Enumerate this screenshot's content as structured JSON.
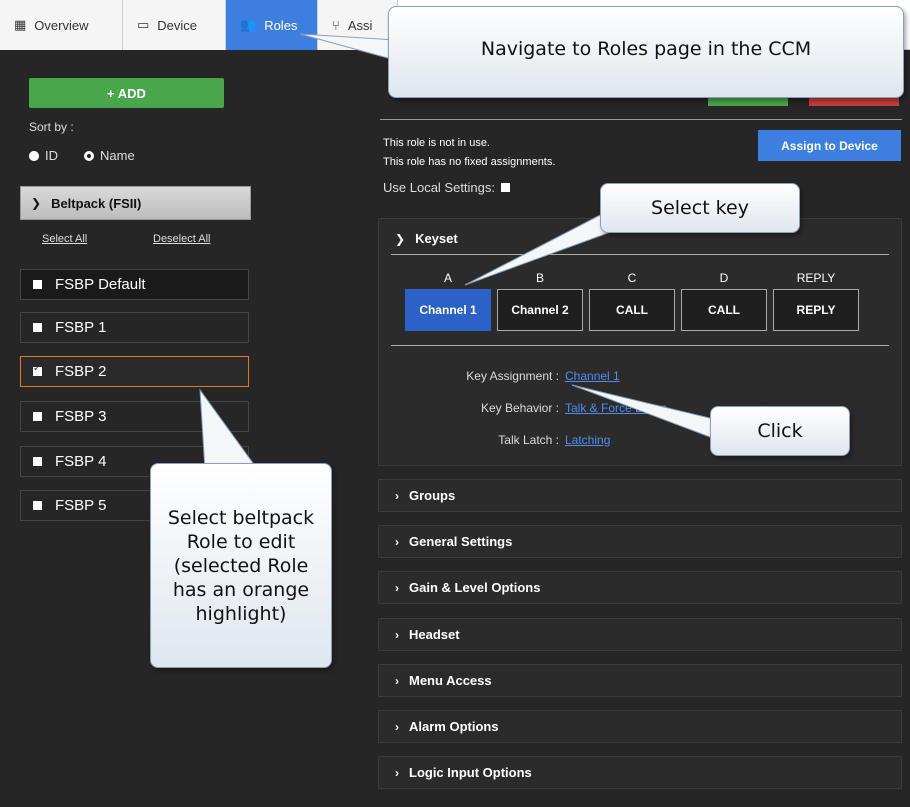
{
  "tabs": [
    {
      "label": "Overview",
      "icon": "grid-icon"
    },
    {
      "label": "Device",
      "icon": "device-icon"
    },
    {
      "label": "Roles",
      "icon": "users-icon"
    },
    {
      "label": "Assi",
      "icon": "assign-icon"
    }
  ],
  "left": {
    "add_label": "+ ADD",
    "sort_by": "Sort by :",
    "sort_options": [
      "ID",
      "Name"
    ],
    "beltpack_header": "Beltpack (FSII)",
    "select_all": "Select All",
    "deselect_all": "Deselect All",
    "roles": [
      {
        "label": "FSBP Default",
        "checked": false
      },
      {
        "label": "FSBP 1",
        "checked": false
      },
      {
        "label": "FSBP 2",
        "checked": true
      },
      {
        "label": "FSBP 3",
        "checked": false
      },
      {
        "label": "FSBP 4",
        "checked": false
      },
      {
        "label": "FSBP 5",
        "checked": false
      }
    ]
  },
  "right": {
    "info_line1": "This role is not in use.",
    "info_line2": "This role has no fixed assignments.",
    "assign_label": "Assign to Device",
    "use_local": "Use Local Settings:",
    "keyset_title": "Keyset",
    "keys": [
      {
        "letter": "A",
        "label": "Channel 1"
      },
      {
        "letter": "B",
        "label": "Channel 2"
      },
      {
        "letter": "C",
        "label": "CALL"
      },
      {
        "letter": "D",
        "label": "CALL"
      },
      {
        "letter": "REPLY",
        "label": "REPLY"
      }
    ],
    "key_assignment_label": "Key Assignment :",
    "key_assignment_value": "Channel 1",
    "key_behavior_label": "Key Behavior :",
    "key_behavior_value": "Talk & Force Listen",
    "talk_latch_label": "Talk Latch :",
    "talk_latch_value": "Latching",
    "sections": [
      "Groups",
      "General Settings",
      "Gain & Level Options",
      "Headset",
      "Menu Access",
      "Alarm Options",
      "Logic Input Options"
    ]
  },
  "callouts": {
    "nav": "Navigate to Roles page in the CCM",
    "key": "Select key",
    "click": "Click",
    "role": "Select beltpack Role to edit (selected Role has an orange highlight)"
  },
  "colors": {
    "accent_blue": "#3d7fe0",
    "add_green": "#4aa64a",
    "selected_orange": "#e07b22",
    "link_blue": "#4f8ef0"
  }
}
